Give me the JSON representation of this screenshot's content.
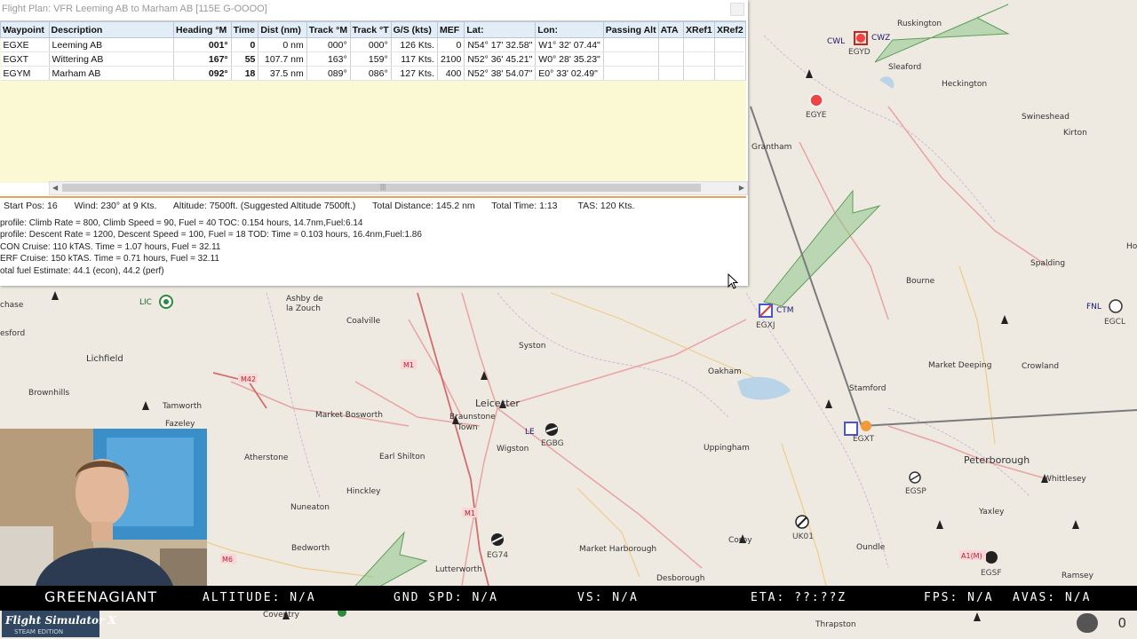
{
  "flight_plan": {
    "title": "Flight Plan: VFR Leeming AB to Marham AB [115E G-OOOO]",
    "columns": [
      "Waypoint",
      "Description",
      "Heading °M",
      "Time",
      "Dist (nm)",
      "Track °M",
      "Track °T",
      "G/S (kts)",
      "MEF",
      "Lat:",
      "Lon:",
      "Passing Alt",
      "ATA",
      "XRef1",
      "XRef2"
    ],
    "rows": [
      {
        "waypoint": "EGXE",
        "description": "Leeming AB",
        "heading": "001°",
        "time": "0",
        "dist": "0 nm",
        "track_m": "000°",
        "track_t": "000°",
        "gs": "126 Kts.",
        "mef": "0",
        "lat": "N54° 17' 32.58\"",
        "lon": "W1° 32' 07.44\""
      },
      {
        "waypoint": "EGXT",
        "description": "Wittering AB",
        "heading": "167°",
        "time": "55",
        "dist": "107.7 nm",
        "track_m": "163°",
        "track_t": "159°",
        "gs": "117 Kts.",
        "mef": "2100",
        "lat": "N52° 36' 45.21\"",
        "lon": "W0° 28' 35.23\""
      },
      {
        "waypoint": "EGYM",
        "description": "Marham AB",
        "heading": "092°",
        "time": "18",
        "dist": "37.5 nm",
        "track_m": "089°",
        "track_t": "086°",
        "gs": "127 Kts.",
        "mef": "400",
        "lat": "N52° 38' 54.07\"",
        "lon": "E0° 33' 02.49\""
      }
    ],
    "summary": {
      "start_pos": "Start Pos: 16",
      "wind": "Wind: 230° at 9 Kts.",
      "altitude": "Altitude: 7500ft. (Suggested Altitude 7500ft.)",
      "total_distance": "Total Distance: 145.2 nm",
      "total_time": "Total Time: 1:13",
      "tas": "TAS: 120 Kts."
    },
    "profile_lines": [
      "profile: Climb Rate = 800, Climb Speed = 90, Fuel = 40 TOC: 0.154 hours, 14.7nm,Fuel:6.14",
      "profile: Descent Rate = 1200, Descent Speed = 100, Fuel = 18 TOD: Time = 0.103 hours, 16.4nm,Fuel:1.86",
      "CON Cruise: 110 kTAS. Time = 1.07 hours, Fuel = 32.11",
      "ERF Cruise: 150 kTAS. Time = 0.71 hours, Fuel = 32.11",
      "otal fuel Estimate: 44.1 (econ), 44.2 (perf)"
    ]
  },
  "map_labels": {
    "places": [
      "Ruskington",
      "Sleaford",
      "Heckington",
      "Swineshead",
      "Kirton",
      "Spalding",
      "Bourne",
      "Grantham",
      "Oakham",
      "Stamford",
      "Market Deeping",
      "Crowland",
      "Peterborough",
      "Whittlesey",
      "Yaxley",
      "Ramsey",
      "Oundle",
      "Uppingham",
      "Market Harborough",
      "Lutterworth",
      "Leicester",
      "Wigston",
      "Braunstone Town",
      "Syston",
      "Coalville",
      "Ashby de la Zouch",
      "Market Bosworth",
      "Earl Shilton",
      "Hinckley",
      "Nuneaton",
      "Atherstone",
      "Tamworth",
      "Lichfield",
      "Brownhills",
      "Fazeley",
      "Bedworth",
      "Coventry",
      "Desborough",
      "Thrapston",
      "Corby",
      "Ho"
    ],
    "airfields": [
      "EGYD",
      "EGYE",
      "EGXJ",
      "EGXT",
      "EGSP",
      "EGCL",
      "EGBG",
      "EG74",
      "UK01",
      "EGSF",
      "CWZ",
      "CWL",
      "CTM",
      "FNL",
      "LIC",
      "LE",
      "A1(M)",
      "M1",
      "M42",
      "M6"
    ]
  },
  "hud": {
    "pilot": "GREENAGIANT",
    "altitude": "ALTITUDE: N/A",
    "gnd_spd": "GND SPD: N/A",
    "vs": "VS: N/A",
    "eta": "ETA: ??:??Z",
    "fps": "FPS: N/A",
    "avas": "AVAS: N/A"
  },
  "branding": {
    "logo_text": "Flight Simulator X",
    "edition": "STEAM EDITION",
    "viewer_count": "0"
  }
}
